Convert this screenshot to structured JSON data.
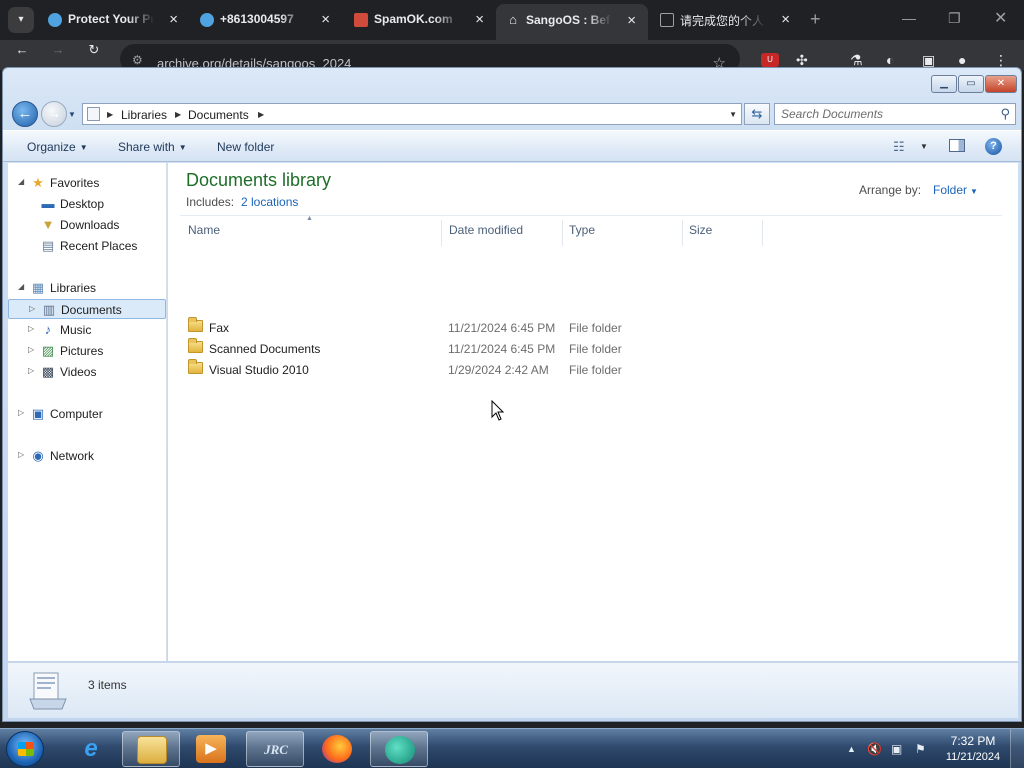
{
  "browser": {
    "tabs": [
      {
        "title": "Protect Your Pr",
        "favicon_color": "#4fa3e0",
        "active": false
      },
      {
        "title": "+8613004597",
        "favicon_color": "#4fa3e0",
        "active": false
      },
      {
        "title": "SpamOK.com",
        "favicon_color": "#d14b3c",
        "active": false
      },
      {
        "title": "SangoOS : Bef",
        "favicon_color": "#e8eaed",
        "active": true
      },
      {
        "title": "请完成您的个人",
        "favicon_color": "#9aa0a6",
        "active": false
      }
    ],
    "url": "archive.org/details/sangoos_2024",
    "ext_badge": "U"
  },
  "explorer": {
    "breadcrumb": [
      "Libraries",
      "Documents"
    ],
    "search_placeholder": "Search Documents",
    "toolbar": {
      "organize": "Organize",
      "share_with": "Share with",
      "new_folder": "New folder"
    },
    "nav": {
      "favorites": "Favorites",
      "desktop": "Desktop",
      "downloads": "Downloads",
      "recent_places": "Recent Places",
      "libraries": "Libraries",
      "documents": "Documents",
      "music": "Music",
      "pictures": "Pictures",
      "videos": "Videos",
      "computer": "Computer",
      "network": "Network"
    },
    "library": {
      "title": "Documents library",
      "includes_label": "Includes:",
      "locations": "2 locations",
      "arrange_label": "Arrange by:",
      "arrange_value": "Folder"
    },
    "columns": {
      "name": "Name",
      "date_modified": "Date modified",
      "type": "Type",
      "size": "Size"
    },
    "files": [
      {
        "name": "Fax",
        "date": "11/21/2024 6:45 PM",
        "type": "File folder"
      },
      {
        "name": "Scanned Documents",
        "date": "11/21/2024 6:45 PM",
        "type": "File folder"
      },
      {
        "name": "Visual Studio 2010",
        "date": "1/29/2024 2:42 AM",
        "type": "File folder"
      }
    ],
    "status": {
      "item_count": "3 items"
    }
  },
  "taskbar": {
    "jrc_label": "JRC",
    "time": "7:32 PM",
    "date": "11/21/2024"
  }
}
